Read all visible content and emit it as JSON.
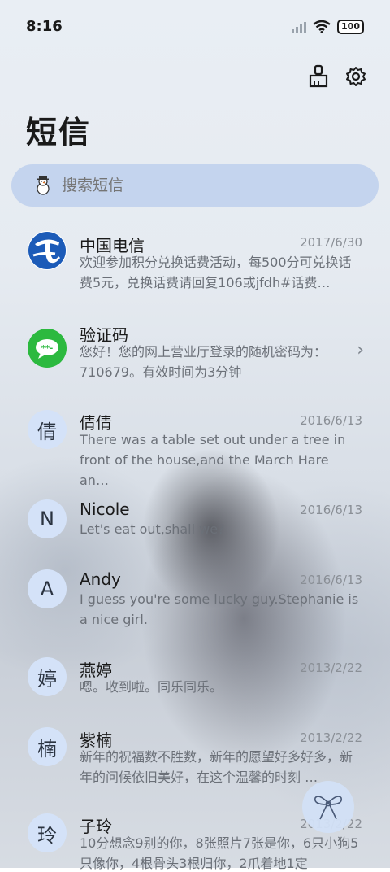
{
  "status_bar": {
    "time": "8:16",
    "battery": "100"
  },
  "header": {
    "title": "短信"
  },
  "search": {
    "placeholder": "搜索短信"
  },
  "conversations": [
    {
      "avatar": "",
      "name": "中国电信",
      "date": "2017/6/30",
      "preview": "欢迎参加积分兑换话费活动，每500分可兑换话费5元，兑换话费请回复106或jfdh#话费…"
    },
    {
      "avatar": "",
      "name": "验证码",
      "date": "",
      "preview": "您好！您的网上营业厅登录的随机密码为：710679。有效时间为3分钟"
    },
    {
      "avatar": "倩",
      "name": "倩倩",
      "date": "2016/6/13",
      "preview": "There was a table set out under a tree in front of the house,and the March Hare an…"
    },
    {
      "avatar": "N",
      "name": "Nicole",
      "date": "2016/6/13",
      "preview": "Let's eat out,shall we?"
    },
    {
      "avatar": "A",
      "name": "Andy",
      "date": "2016/6/13",
      "preview": "I guess you're some lucky guy.Stephanie is a nice girl."
    },
    {
      "avatar": "婷",
      "name": "燕婷",
      "date": "2013/2/22",
      "preview": "嗯。收到啦。同乐同乐。"
    },
    {
      "avatar": "楠",
      "name": "紫楠",
      "date": "2013/2/22",
      "preview": "新年的祝福数不胜数，新年的愿望好多好多，新年的问候依旧美好，在这个温馨的时刻 …"
    },
    {
      "avatar": "玲",
      "name": "子玲",
      "date": "2013/2/22",
      "preview": "10分想念9别的你，8张照片7张是你，6只小狗5只像你，4根骨头3根归你，2爪着地1定"
    }
  ]
}
